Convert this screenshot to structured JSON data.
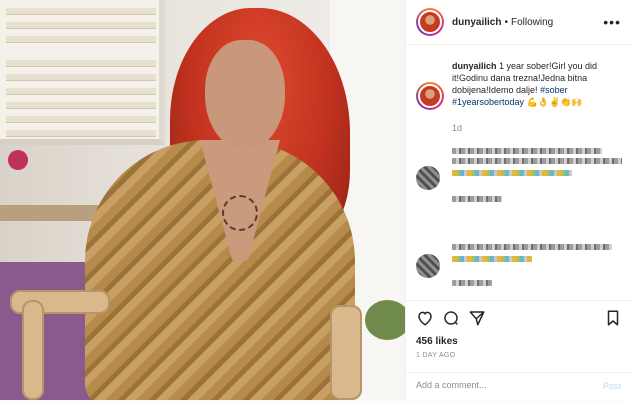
{
  "header": {
    "username": "dunyailich",
    "separator": "•",
    "follow_status": "Following",
    "more_icon": "more-horizontal-icon"
  },
  "caption": {
    "username": "dunyailich",
    "text": " 1 year sober!Girl you did it!Godinu dana trezna!Jedna bitna dobijena!Idemo dalje! ",
    "hashtag_1": "#sober",
    "hashtag_2": "#1yearsobertoday",
    "emojis": "💪👌✌👏🙌",
    "age": "1d"
  },
  "actions": {
    "like_icon": "heart-icon",
    "comment_icon": "comment-icon",
    "share_icon": "share-icon",
    "save_icon": "bookmark-icon",
    "likes": "456 likes",
    "timestamp": "1 DAY AGO"
  },
  "comment_box": {
    "placeholder": "Add a comment...",
    "post_label": "Post"
  },
  "colors": {
    "link": "#003569",
    "post_button_disabled": "#b2dffc",
    "muted": "#8e8e8e"
  }
}
